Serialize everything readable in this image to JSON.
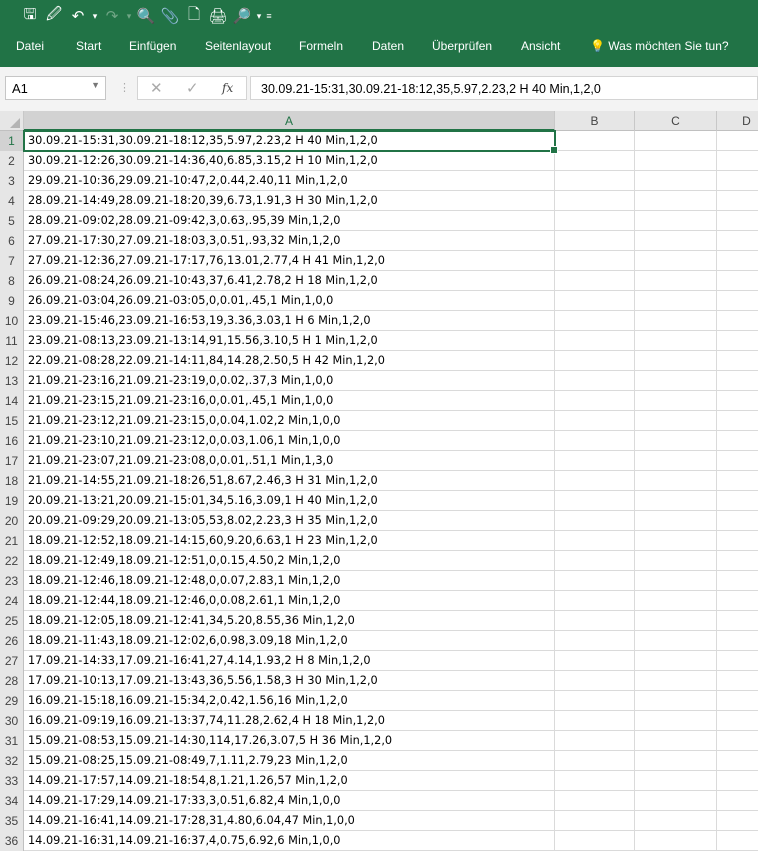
{
  "quick_access": [
    "save-icon",
    "save-as-icon",
    "undo-icon",
    "redo-icon",
    "print-preview-icon",
    "attach-icon",
    "new-document-icon",
    "print-icon",
    "preview-dropdown-icon",
    "customize-icon"
  ],
  "menu": [
    "Datei",
    "Start",
    "Einfügen",
    "Seitenlayout",
    "Formeln",
    "Daten",
    "Überprüfen",
    "Ansicht",
    "Was möchten Sie tun?"
  ],
  "namebox": "A1",
  "fx_label": "fx",
  "formula": "30.09.21-15:31,30.09.21-18:12,35,5.97,2.23,2 H 40 Min,1,2,0",
  "columns": [
    "A",
    "B",
    "C",
    "D"
  ],
  "rows": [
    "30.09.21-15:31,30.09.21-18:12,35,5.97,2.23,2 H 40 Min,1,2,0",
    "30.09.21-12:26,30.09.21-14:36,40,6.85,3.15,2 H 10 Min,1,2,0",
    "29.09.21-10:36,29.09.21-10:47,2,0.44,2.40,11 Min,1,2,0",
    "28.09.21-14:49,28.09.21-18:20,39,6.73,1.91,3 H 30 Min,1,2,0",
    "28.09.21-09:02,28.09.21-09:42,3,0.63,.95,39 Min,1,2,0",
    "27.09.21-17:30,27.09.21-18:03,3,0.51,.93,32 Min,1,2,0",
    "27.09.21-12:36,27.09.21-17:17,76,13.01,2.77,4 H 41 Min,1,2,0",
    "26.09.21-08:24,26.09.21-10:43,37,6.41,2.78,2 H 18 Min,1,2,0",
    "26.09.21-03:04,26.09.21-03:05,0,0.01,.45,1 Min,1,0,0",
    "23.09.21-15:46,23.09.21-16:53,19,3.36,3.03,1 H 6 Min,1,2,0",
    "23.09.21-08:13,23.09.21-13:14,91,15.56,3.10,5 H 1 Min,1,2,0",
    "22.09.21-08:28,22.09.21-14:11,84,14.28,2.50,5 H 42 Min,1,2,0",
    "21.09.21-23:16,21.09.21-23:19,0,0.02,.37,3 Min,1,0,0",
    "21.09.21-23:15,21.09.21-23:16,0,0.01,.45,1 Min,1,0,0",
    "21.09.21-23:12,21.09.21-23:15,0,0.04,1.02,2 Min,1,0,0",
    "21.09.21-23:10,21.09.21-23:12,0,0.03,1.06,1 Min,1,0,0",
    "21.09.21-23:07,21.09.21-23:08,0,0.01,.51,1 Min,1,3,0",
    "21.09.21-14:55,21.09.21-18:26,51,8.67,2.46,3 H 31 Min,1,2,0",
    "20.09.21-13:21,20.09.21-15:01,34,5.16,3.09,1 H 40 Min,1,2,0",
    "20.09.21-09:29,20.09.21-13:05,53,8.02,2.23,3 H 35 Min,1,2,0",
    "18.09.21-12:52,18.09.21-14:15,60,9.20,6.63,1 H 23 Min,1,2,0",
    "18.09.21-12:49,18.09.21-12:51,0,0.15,4.50,2 Min,1,2,0",
    "18.09.21-12:46,18.09.21-12:48,0,0.07,2.83,1 Min,1,2,0",
    "18.09.21-12:44,18.09.21-12:46,0,0.08,2.61,1 Min,1,2,0",
    "18.09.21-12:05,18.09.21-12:41,34,5.20,8.55,36 Min,1,2,0",
    "18.09.21-11:43,18.09.21-12:02,6,0.98,3.09,18 Min,1,2,0",
    "17.09.21-14:33,17.09.21-16:41,27,4.14,1.93,2 H 8 Min,1,2,0",
    "17.09.21-10:13,17.09.21-13:43,36,5.56,1.58,3 H 30 Min,1,2,0",
    "16.09.21-15:18,16.09.21-15:34,2,0.42,1.56,16 Min,1,2,0",
    "16.09.21-09:19,16.09.21-13:37,74,11.28,2.62,4 H 18 Min,1,2,0",
    "15.09.21-08:53,15.09.21-14:30,114,17.26,3.07,5 H 36 Min,1,2,0",
    "15.09.21-08:25,15.09.21-08:49,7,1.11,2.79,23 Min,1,2,0",
    "14.09.21-17:57,14.09.21-18:54,8,1.21,1.26,57 Min,1,2,0",
    "14.09.21-17:29,14.09.21-17:33,3,0.51,6.82,4 Min,1,0,0",
    "14.09.21-16:41,14.09.21-17:28,31,4.80,6.04,47 Min,1,0,0",
    "14.09.21-16:31,14.09.21-16:37,4,0.75,6.92,6 Min,1,0,0"
  ]
}
